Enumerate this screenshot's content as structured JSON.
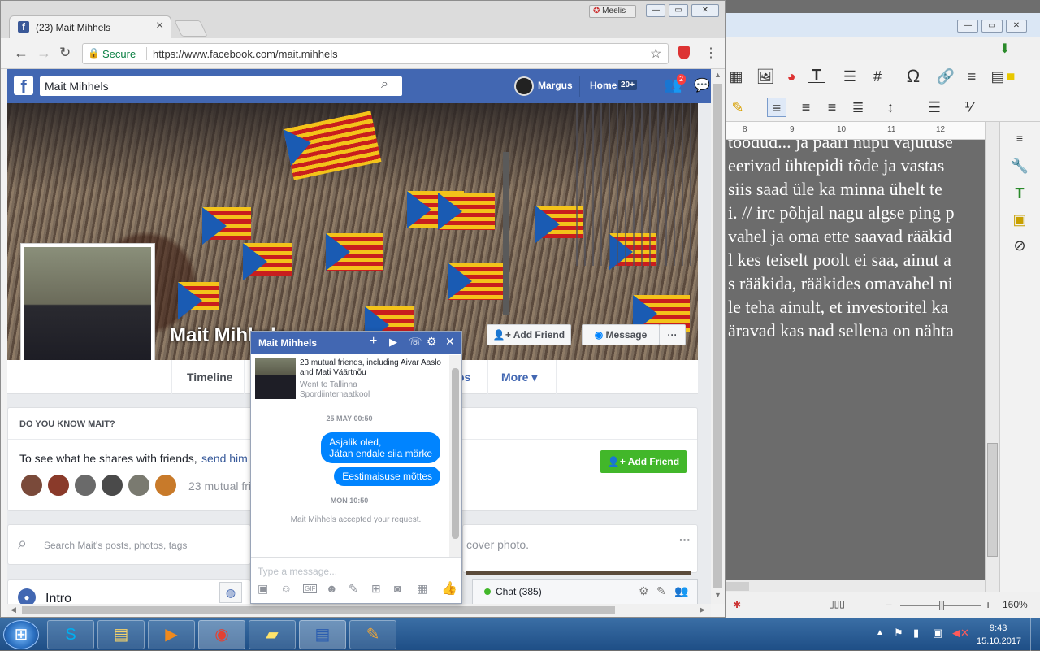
{
  "chrome": {
    "tab_title": "(23) Mait Mihhels",
    "tab_close": "×",
    "user_badge": "Meelis",
    "secure_label": "Secure",
    "url": "https://www.facebook.com/mait.mihhels"
  },
  "facebook": {
    "search_value": "Mait Mihhels",
    "user_name": "Margus",
    "home_label": "Home",
    "home_badge": "20+",
    "friend_requests_badge": "2",
    "profile_name": "Mait Mihhels",
    "add_friend_label": "Add Friend",
    "message_label": "Message",
    "more_dots": "···",
    "tabs": {
      "timeline": "Timeline",
      "photos": "os",
      "more": "More ▾"
    },
    "know_heading": "DO YOU KNOW MAIT?",
    "know_text": "To see what he shares with friends,",
    "know_link": "send him",
    "mutual_text": "23 mutual fri",
    "search_posts_placeholder": "Search Mait's posts, photos, tags",
    "cover_photo_text": "cover photo.",
    "intro_label": "Intro",
    "chat_label": "Chat (385)"
  },
  "messenger": {
    "title": "Mait Mihhels",
    "mutual_info": "23 mutual friends, including Aivar Aaslo and Mati Väärtnõu",
    "school_info": "Went to Tallinna Spordiinternaatkool",
    "ts1": "25 MAY 00:50",
    "msg1": "Asjalik oled,",
    "msg2": "Jätan endale siia märke",
    "msg3": "Eestimaisuse mõttes",
    "ts2": "MON 10:50",
    "accepted": "Mait Mihhels accepted your request.",
    "input_placeholder": "Type a message..."
  },
  "libreoffice": {
    "ruler_marks": [
      "8",
      "9",
      "10",
      "11",
      "12"
    ],
    "doc_lines": [
      "toodud... ja paari nupu vajutuse",
      "eerivad ühtepidi tõde ja vastas",
      " siis saad üle ka minna ühelt te",
      "i. // irc põhjal nagu algse ping p",
      "vahel ja oma ette saavad rääkid",
      "l kes teiselt poolt ei saa, ainut a",
      "s rääkida, rääkides omavahel ni",
      "le teha ainult, et investoritel ka",
      "äravad kas nad sellena on nähta"
    ],
    "zoom": "160%"
  },
  "taskbar": {
    "time": "9:43",
    "date": "15.10.2017"
  },
  "colors": {
    "facebook_blue": "#4267b2",
    "messenger_blue": "#0084ff",
    "add_friend_green": "#42b72a"
  }
}
